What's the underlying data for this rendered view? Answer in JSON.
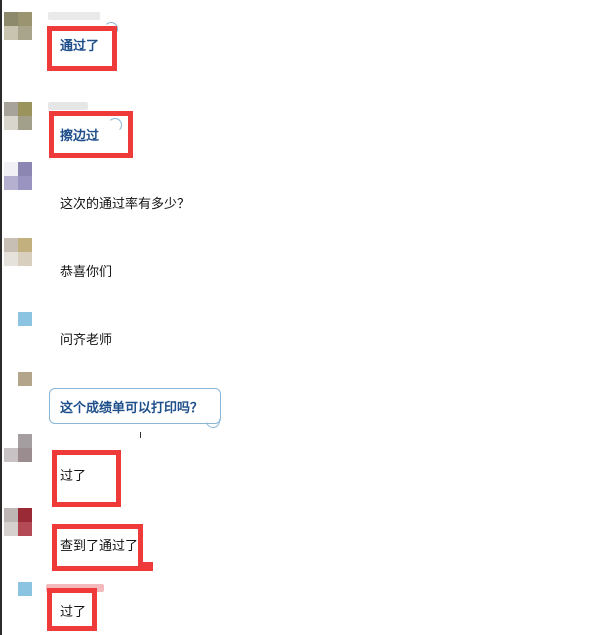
{
  "colors": {
    "highlight": "#ef3a3a",
    "accent_text": "#1e4f8a",
    "bubble_border": "#8ab6d6"
  },
  "messages": [
    {
      "text": "通过了",
      "style": "accent",
      "highlighted": true
    },
    {
      "text": "擦边过",
      "style": "accent",
      "highlighted": true
    },
    {
      "text": "这次的通过率有多少？",
      "style": "plain",
      "highlighted": false
    },
    {
      "text": "恭喜你们",
      "style": "plain",
      "highlighted": false
    },
    {
      "text": "问齐老师",
      "style": "plain",
      "highlighted": false
    },
    {
      "text": "这个成绩单可以打印吗？",
      "style": "accent",
      "highlighted": false
    },
    {
      "text": "过了",
      "style": "plain",
      "highlighted": true
    },
    {
      "text": "查到了通过了",
      "style": "plain",
      "highlighted": true
    },
    {
      "text": "过了",
      "style": "plain",
      "highlighted": true
    }
  ]
}
